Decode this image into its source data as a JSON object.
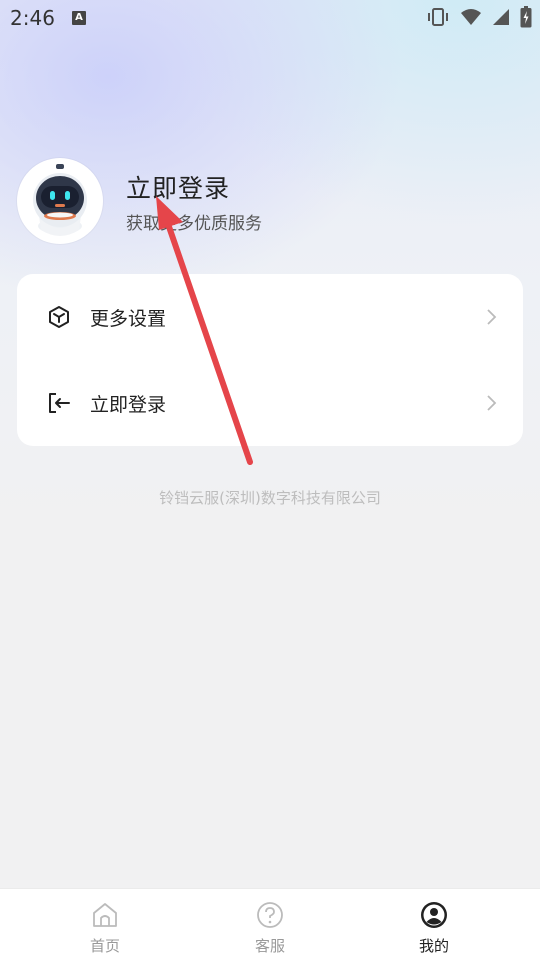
{
  "status_bar": {
    "time": "2:46",
    "notification_icon": "A"
  },
  "profile": {
    "title": "立即登录",
    "subtitle": "获取更多优质服务"
  },
  "menu": [
    {
      "label": "更多设置",
      "icon": "cube-icon"
    },
    {
      "label": "立即登录",
      "icon": "login-icon"
    }
  ],
  "footer": {
    "company": "铃铛云服(深圳)数字科技有限公司"
  },
  "tabs": [
    {
      "label": "首页",
      "icon": "home-icon",
      "active": false
    },
    {
      "label": "客服",
      "icon": "help-icon",
      "active": false
    },
    {
      "label": "我的",
      "icon": "user-icon",
      "active": true
    }
  ],
  "colors": {
    "annotation_arrow": "#e5454a",
    "active_tab": "#222222",
    "inactive_tab": "#999999"
  }
}
